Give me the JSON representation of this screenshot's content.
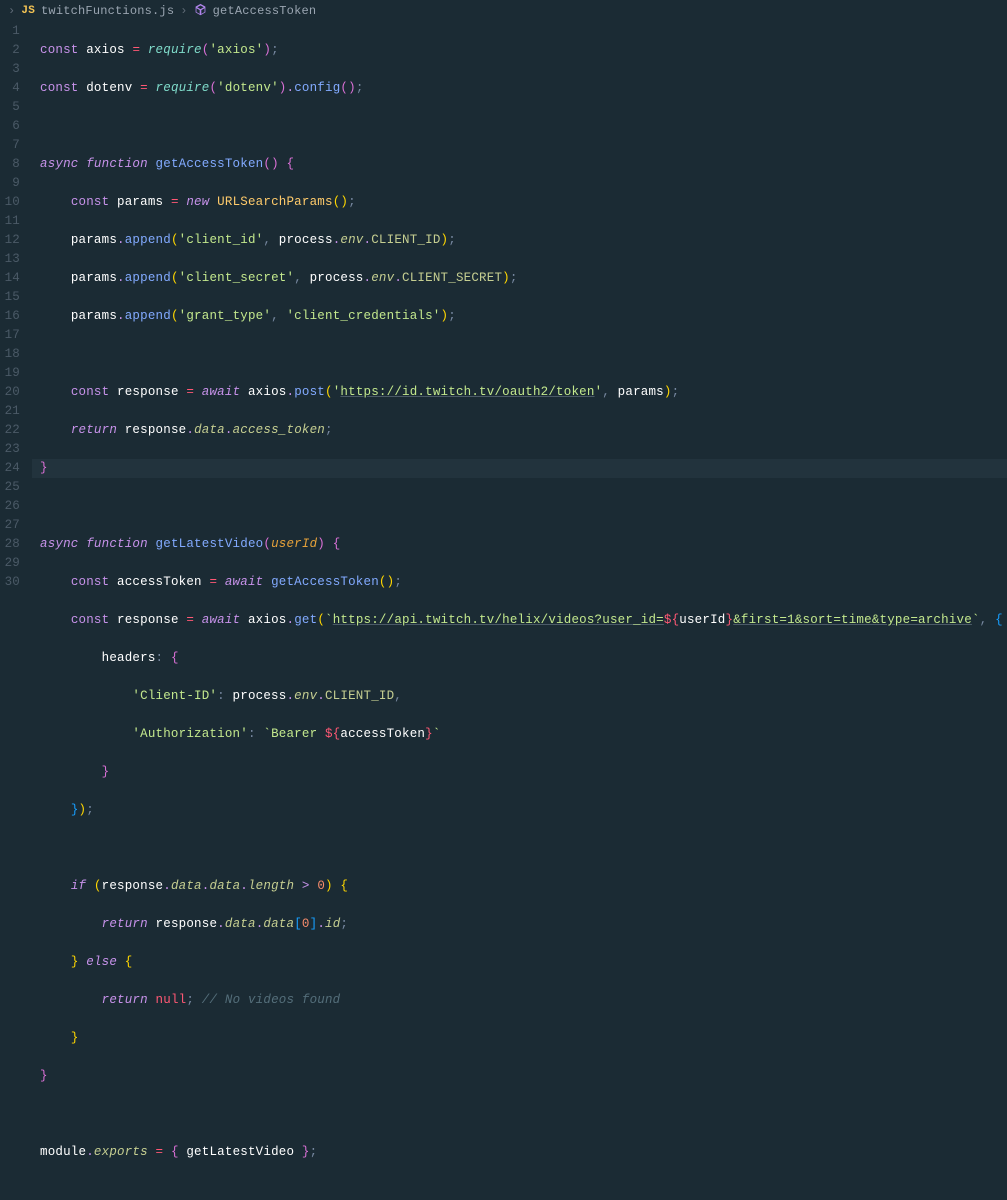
{
  "breadcrumbs": {
    "file": "twitchFunctions.js",
    "symbol": "getAccessToken"
  },
  "gutter": [
    "1",
    "2",
    "3",
    "4",
    "5",
    "6",
    "7",
    "8",
    "9",
    "10",
    "11",
    "12",
    "13",
    "14",
    "15",
    "16",
    "17",
    "18",
    "19",
    "20",
    "21",
    "22",
    "23",
    "24",
    "25",
    "26",
    "27",
    "28",
    "29",
    "30"
  ],
  "code": {
    "const": "const",
    "async": "async",
    "function": "function",
    "new": "new",
    "await": "await",
    "return": "return",
    "if": "if",
    "else": "else",
    "null": "null",
    "axios": "axios",
    "dotenv": "dotenv",
    "require": "require",
    "axios_str": "'axios'",
    "dotenv_str": "'dotenv'",
    "config": "config",
    "getAccessToken": "getAccessToken",
    "getLatestVideo": "getLatestVideo",
    "params": "params",
    "URLSearchParams": "URLSearchParams",
    "append": "append",
    "client_id_str": "'client_id'",
    "client_secret_str": "'client_secret'",
    "grant_type_str": "'grant_type'",
    "client_creds_str": "'client_credentials'",
    "process": "process",
    "env": "env",
    "CLIENT_ID": "CLIENT_ID",
    "CLIENT_SECRET": "CLIENT_SECRET",
    "response": "response",
    "post": "post",
    "get": "get",
    "token_url": "https://id.twitch.tv/oauth2/token",
    "data": "data",
    "access_token": "access_token",
    "userId": "userId",
    "accessToken": "accessToken",
    "helix_pre": "https://api.twitch.tv/helix/videos?user_id=",
    "helix_post": "&first=1&sort=time&type=archive",
    "headers": "headers",
    "ClientID_key": "'Client-ID'",
    "Auth_key": "'Authorization'",
    "Bearer": "Bearer ",
    "length": "length",
    "gt": ">",
    "zero": "0",
    "id": "id",
    "comment_novideo": "// No videos found",
    "module": "module",
    "exports": "exports",
    "dollar_open": "${",
    "brace_close": "}"
  }
}
